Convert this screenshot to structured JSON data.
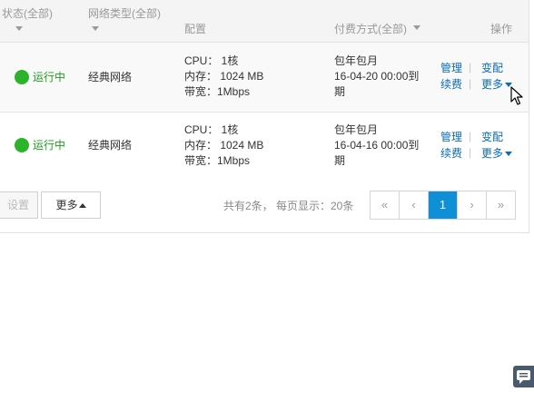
{
  "header": {
    "status": "状态(全部)",
    "network": "网络类型(全部)",
    "config": "配置",
    "billing": "付费方式(全部)",
    "actions": "操作"
  },
  "rows": [
    {
      "status": "运行中",
      "network": "经典网络",
      "cpu": "CPU： 1核",
      "mem": "内存： 1024 MB",
      "bw": "带宽：1Mbps",
      "billing_type": "包年包月",
      "expiry_line1": "16-04-20 00:00到",
      "expiry_line2": "期",
      "manage": "管理",
      "upgrade": "变配",
      "renew": "续费",
      "more": "更多"
    },
    {
      "status": "运行中",
      "network": "经典网络",
      "cpu": "CPU： 1核",
      "mem": "内存： 1024 MB",
      "bw": "带宽：1Mbps",
      "billing_type": "包年包月",
      "expiry_line1": "16-04-16 00:00到",
      "expiry_line2": "期",
      "manage": "管理",
      "upgrade": "变配",
      "renew": "续费",
      "more": "更多"
    }
  ],
  "footer": {
    "settings_label": "设置",
    "more_label": "更多",
    "summary": "共有2条， 每页显示：20条"
  },
  "pagination": {
    "first": "«",
    "prev": "‹",
    "current": "1",
    "next": "›",
    "last": "»"
  },
  "colors": {
    "status_green": "#2cb32c",
    "link_blue": "#0d6bb8",
    "active_page": "#0f8fd6"
  },
  "icons": {
    "cursor": "mouse-pointer-icon",
    "chat": "chat-bubble-icon"
  }
}
